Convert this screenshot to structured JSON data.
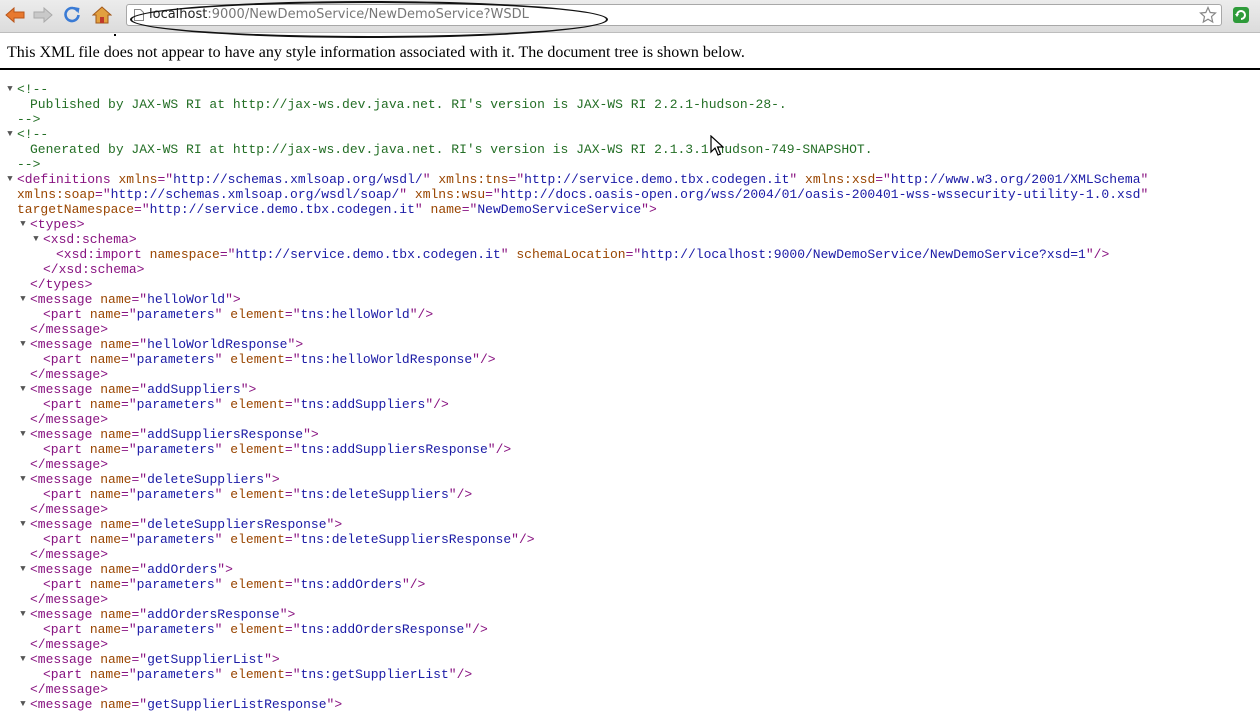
{
  "browser": {
    "url_host": "localhost",
    "url_rest": ":9000/NewDemoService/NewDemoService?WSDL"
  },
  "notice": "This XML file does not appear to have any style information associated with it. The document tree is shown below.",
  "comments": {
    "open": "<!--",
    "close": "-->",
    "published": "Published by JAX-WS RI at http://jax-ws.dev.java.net. RI's version is JAX-WS RI 2.2.1-hudson-28-.",
    "generated": "Generated by JAX-WS RI at http://jax-ws.dev.java.net. RI's version is JAX-WS RI 2.1.3.1-hudson-749-SNAPSHOT."
  },
  "definitions": {
    "attrs": [
      {
        "n": "xmlns",
        "v": "http://schemas.xmlsoap.org/wsdl/"
      },
      {
        "n": "xmlns:tns",
        "v": "http://service.demo.tbx.codegen.it"
      },
      {
        "n": "xmlns:xsd",
        "v": "http://www.w3.org/2001/XMLSchema"
      },
      {
        "n": "xmlns:soap",
        "v": "http://schemas.xmlsoap.org/wsdl/soap/"
      },
      {
        "n": "xmlns:wsu",
        "v": "http://docs.oasis-open.org/wss/2004/01/oasis-200401-wss-wssecurity-utility-1.0.xsd"
      },
      {
        "n": "targetNamespace",
        "v": "http://service.demo.tbx.codegen.it"
      },
      {
        "n": "name",
        "v": "NewDemoServiceService"
      }
    ]
  },
  "import": {
    "namespace": "http://service.demo.tbx.codegen.it",
    "schemaLocation": "http://localhost:9000/NewDemoService/NewDemoService?xsd=1"
  },
  "messages": [
    {
      "name": "helloWorld",
      "element": "tns:helloWorld"
    },
    {
      "name": "helloWorldResponse",
      "element": "tns:helloWorldResponse"
    },
    {
      "name": "addSuppliers",
      "element": "tns:addSuppliers"
    },
    {
      "name": "addSuppliersResponse",
      "element": "tns:addSuppliersResponse"
    },
    {
      "name": "deleteSuppliers",
      "element": "tns:deleteSuppliers"
    },
    {
      "name": "deleteSuppliersResponse",
      "element": "tns:deleteSuppliersResponse"
    },
    {
      "name": "addOrders",
      "element": "tns:addOrders"
    },
    {
      "name": "addOrdersResponse",
      "element": "tns:addOrdersResponse"
    },
    {
      "name": "getSupplierList",
      "element": "tns:getSupplierList"
    },
    {
      "name": "getSupplierListResponse",
      "element": null
    }
  ],
  "part_name": "parameters",
  "icons": [
    "back-arrow-icon",
    "forward-arrow-icon",
    "reload-icon",
    "home-icon",
    "page-icon",
    "bookmark-star-icon",
    "extension-icon",
    "mouse-cursor-icon"
  ],
  "colors": {
    "tag": "#881280",
    "attr_name": "#994500",
    "attr_value": "#1a1aa6",
    "comment": "#236e25"
  }
}
